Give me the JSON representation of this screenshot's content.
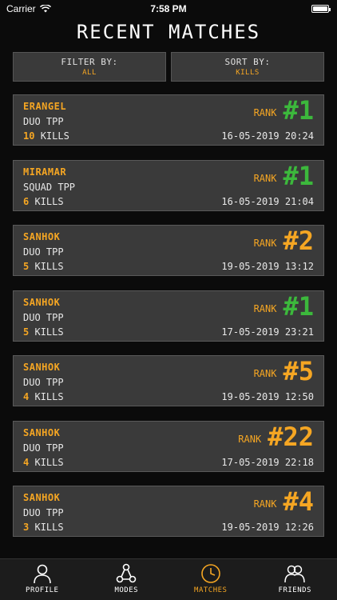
{
  "status_bar": {
    "carrier": "Carrier",
    "time": "7:58 PM",
    "battery_level": 1.0
  },
  "page_title": "RECENT MATCHES",
  "filter": {
    "label": "FILTER BY:",
    "value": "ALL"
  },
  "sort": {
    "label": "SORT BY:",
    "value": "KILLS"
  },
  "rank_label": "RANK",
  "kills_suffix": "KILLS",
  "colors": {
    "accent": "#f5a623",
    "win": "#3cb83c"
  },
  "matches": [
    {
      "map": "ERANGEL",
      "mode": "DUO TPP",
      "kills": "10",
      "rank": "#1",
      "rank_color": "green",
      "date": "16-05-2019 20:24"
    },
    {
      "map": "MIRAMAR",
      "mode": "SQUAD TPP",
      "kills": "6",
      "rank": "#1",
      "rank_color": "green",
      "date": "16-05-2019 21:04"
    },
    {
      "map": "SANHOK",
      "mode": "DUO TPP",
      "kills": "5",
      "rank": "#2",
      "rank_color": "orange",
      "date": "19-05-2019 13:12"
    },
    {
      "map": "SANHOK",
      "mode": "DUO TPP",
      "kills": "5",
      "rank": "#1",
      "rank_color": "green",
      "date": "17-05-2019 23:21"
    },
    {
      "map": "SANHOK",
      "mode": "DUO TPP",
      "kills": "4",
      "rank": "#5",
      "rank_color": "orange",
      "date": "19-05-2019 12:50"
    },
    {
      "map": "SANHOK",
      "mode": "DUO TPP",
      "kills": "4",
      "rank": "#22",
      "rank_color": "orange",
      "date": "17-05-2019 22:18"
    },
    {
      "map": "SANHOK",
      "mode": "DUO TPP",
      "kills": "3",
      "rank": "#4",
      "rank_color": "orange",
      "date": "19-05-2019 12:26"
    }
  ],
  "tabs": [
    {
      "label": "PROFILE",
      "icon": "person-icon",
      "active": false
    },
    {
      "label": "MODES",
      "icon": "modes-icon",
      "active": false
    },
    {
      "label": "MATCHES",
      "icon": "clock-icon",
      "active": true
    },
    {
      "label": "FRIENDS",
      "icon": "friends-icon",
      "active": false
    }
  ]
}
